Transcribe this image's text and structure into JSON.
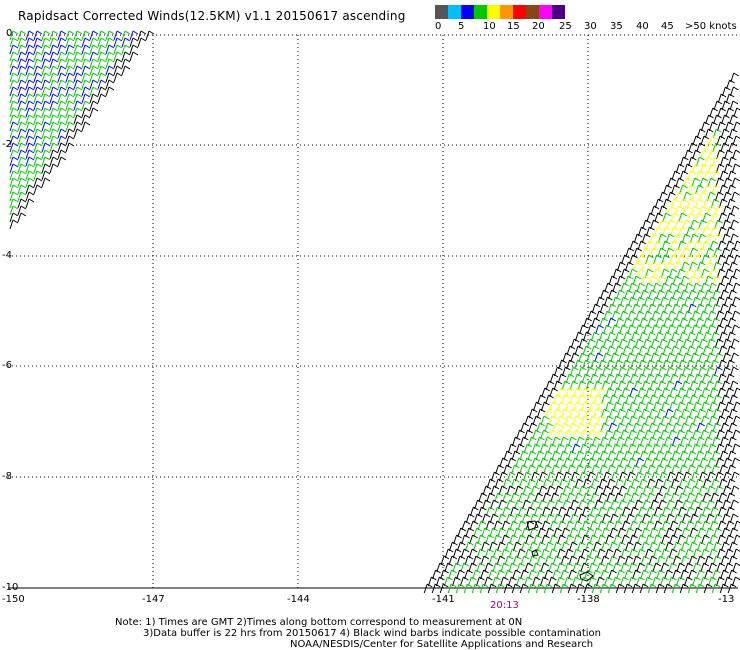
{
  "header": {
    "title": "Rapidsact Corrected Winds(12.5KM) v1.1 20150617 ascending"
  },
  "legend": {
    "colors": [
      "#555555",
      "#00bfff",
      "#0000ff",
      "#00c800",
      "#ffff00",
      "#ff9600",
      "#ff0000",
      "#8b4513",
      "#ff00ff",
      "#4b0082"
    ],
    "labels": [
      "0",
      "5",
      "10",
      "15",
      "20",
      "25",
      "30",
      "35",
      "40",
      "45",
      ">50 knots"
    ]
  },
  "map": {
    "lon_ticks": [
      "-150",
      "-147",
      "-144",
      "-141",
      "-138",
      "-13"
    ],
    "lat_ticks": [
      "0",
      "-2",
      "-4",
      "-6",
      "-8",
      "-10"
    ],
    "pass_time": "20:13"
  },
  "notes": {
    "line1": "Note: 1) Times are GMT 2)Times along bottom correspond to measurement at 0N",
    "line2": "3)Data buffer is 22 hrs from 20150617 4) Black wind barbs indicate possible contamination",
    "line3": "NOAA/NESDIS/Center for Satellite Applications and Research"
  }
}
